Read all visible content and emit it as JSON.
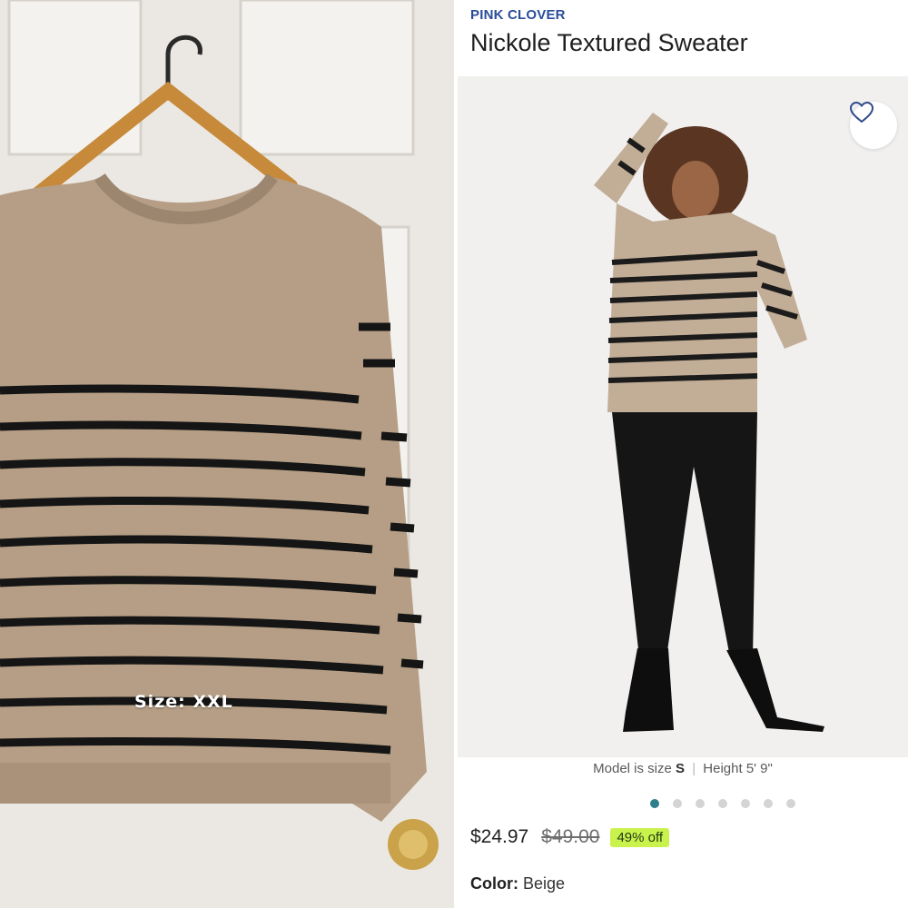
{
  "left_photo": {
    "size_tag": "Size: XXL"
  },
  "product": {
    "brand": "PINK CLOVER",
    "title": "Nickole Textured Sweater",
    "model_info": {
      "size_label": "Model is size",
      "size_value": "S",
      "height_label": "Height",
      "height_value": "5' 9\""
    },
    "carousel": {
      "total": 7,
      "active_index": 0
    },
    "price": "$24.97",
    "original_price": "$49.00",
    "discount": "49% off",
    "color_label": "Color:",
    "color_value": "Beige"
  },
  "colors": {
    "brand": "#2a4d9b",
    "carousel_active": "#2e7f8a",
    "discount_badge": "#c9f24d",
    "sweater": "#b59e85",
    "stripe": "#151515"
  },
  "icons": {
    "favorite": "heart-outline-icon"
  }
}
